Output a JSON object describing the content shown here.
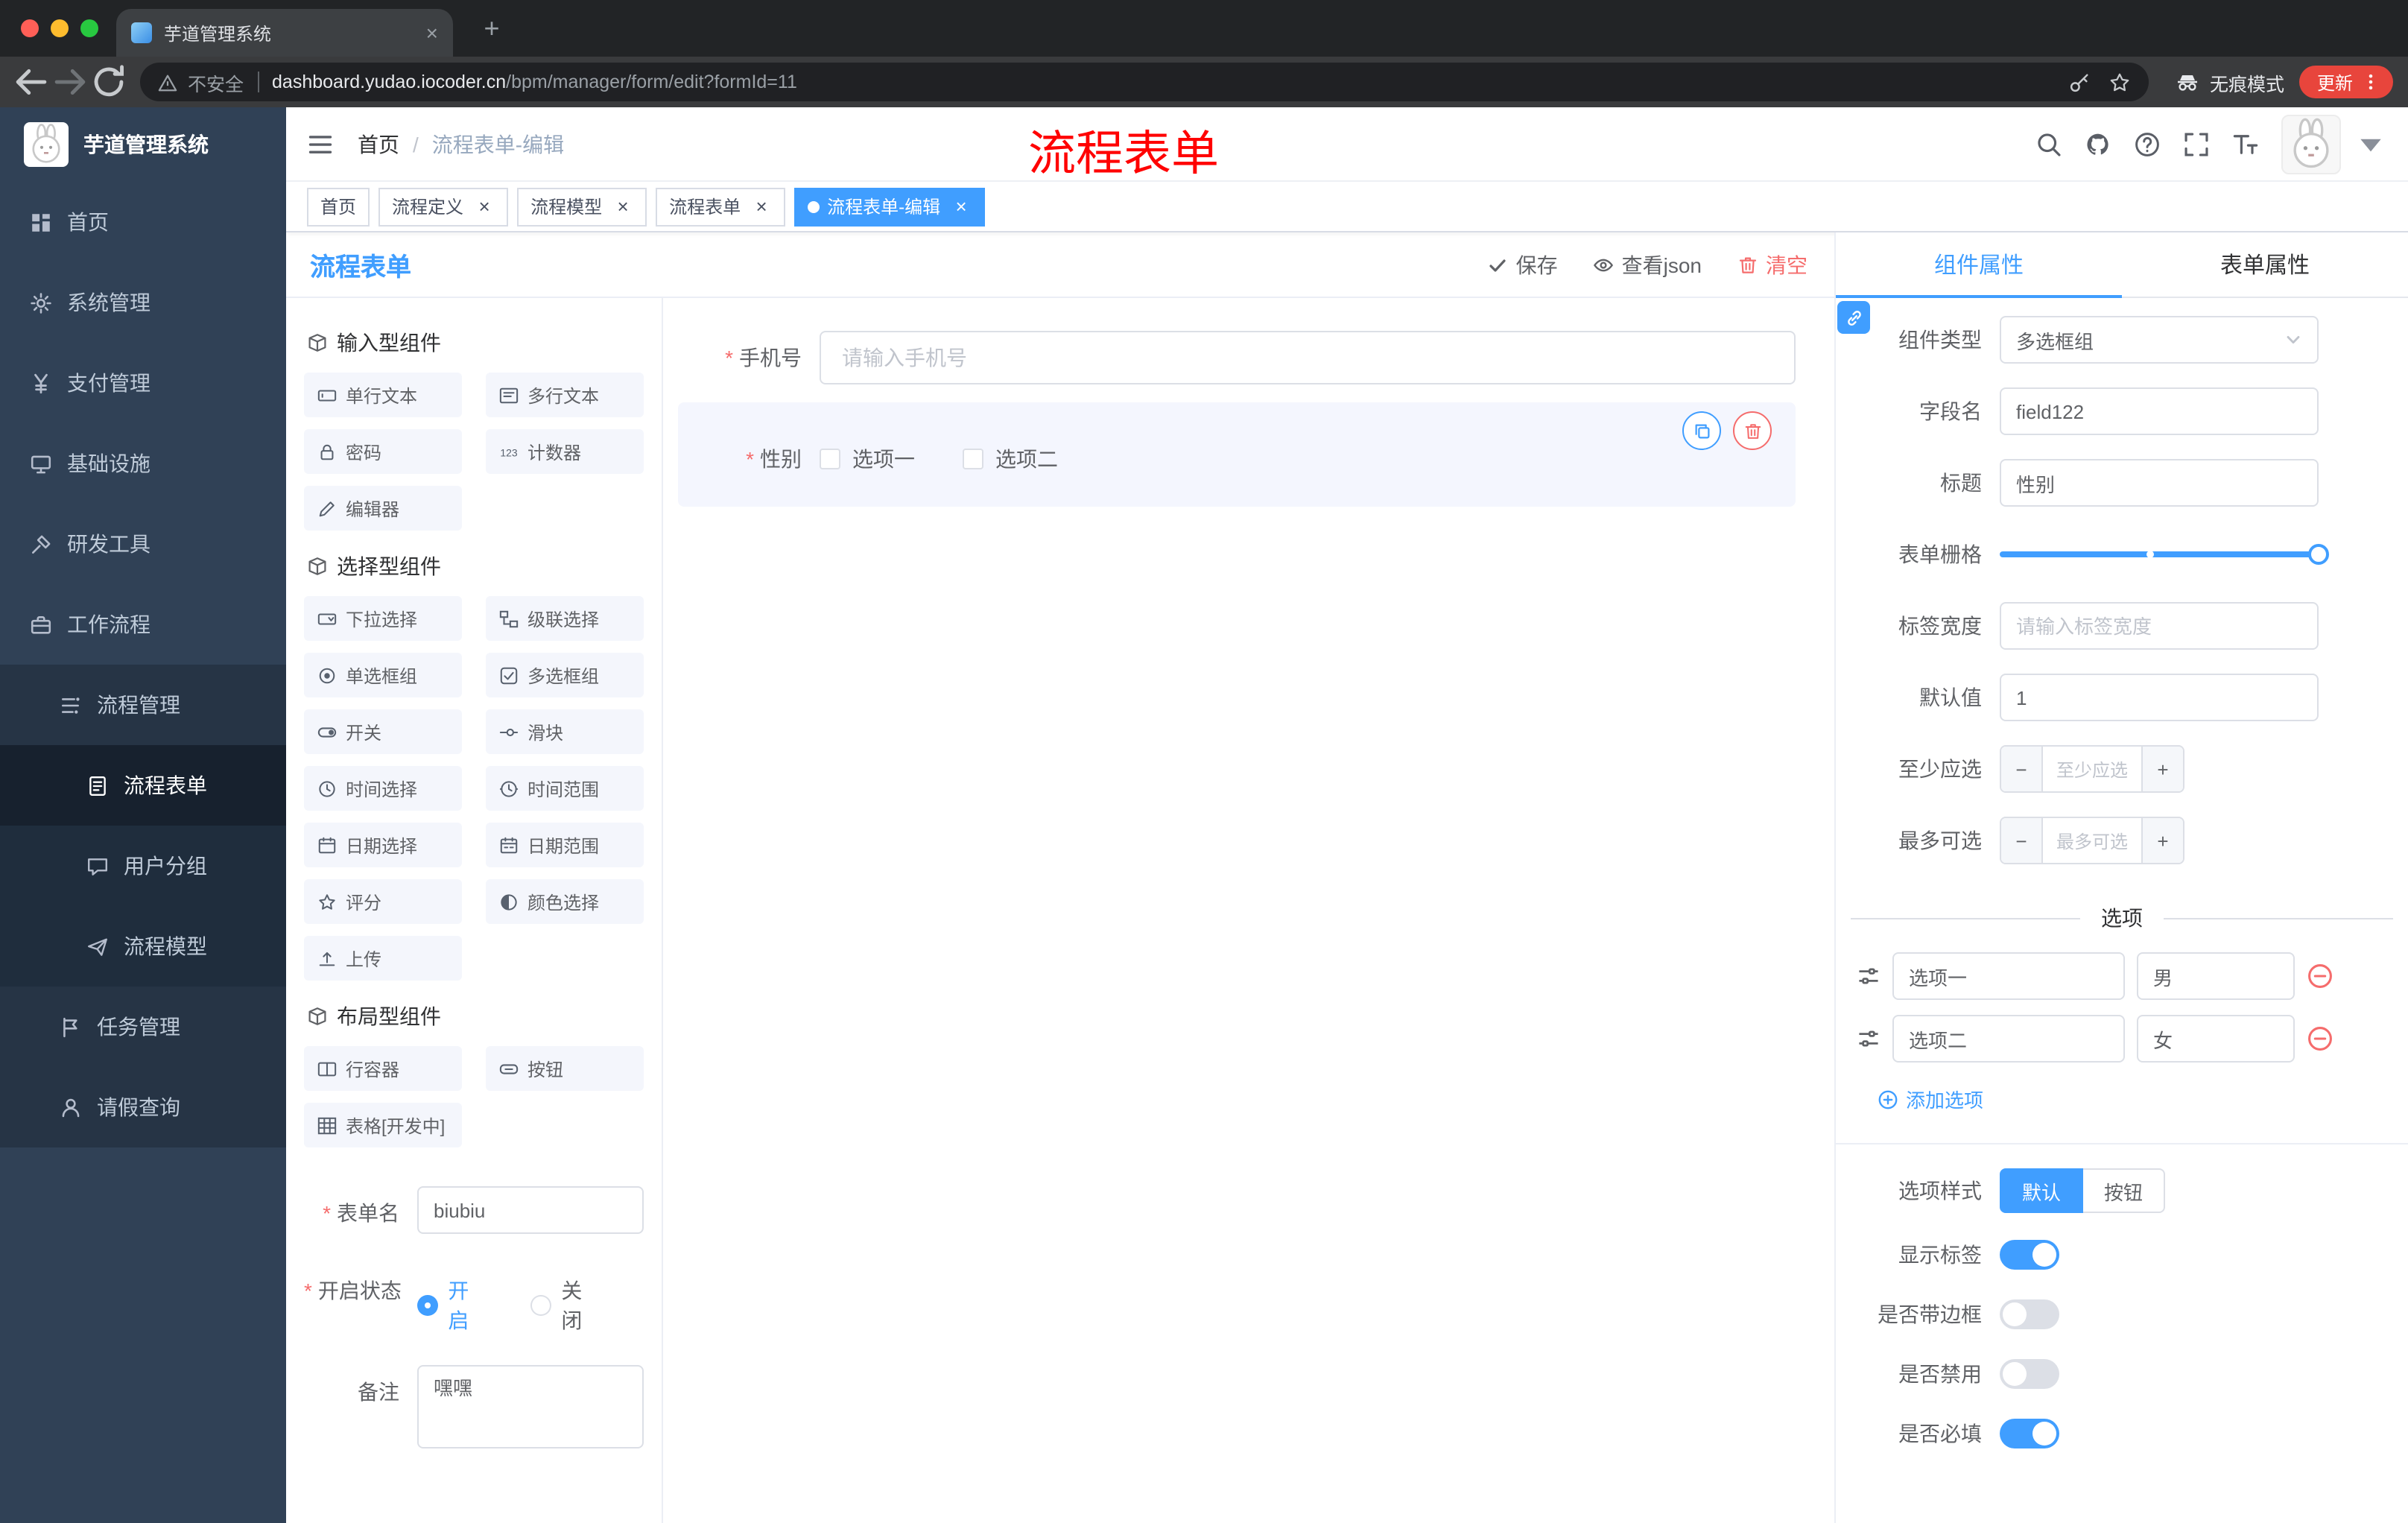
{
  "colors": {
    "primary": "#409EFF",
    "danger": "#F56C6C",
    "sidebar": "#304156",
    "annotation": "#FF0000",
    "update_button": "#E8453C"
  },
  "browser": {
    "tab_title": "芋道管理系统",
    "security_label": "不安全",
    "url_host": "dashboard.yudao.iocoder.cn",
    "url_path": "/bpm/manager/form/edit?formId=11",
    "incognito_label": "无痕模式",
    "update_label": "更新"
  },
  "sidebar": {
    "title": "芋道管理系统",
    "menu": [
      {
        "label": "首页",
        "icon": "home-icon",
        "level": 1
      },
      {
        "label": "系统管理",
        "icon": "gear-icon",
        "level": 1,
        "chevron": "down"
      },
      {
        "label": "支付管理",
        "icon": "yen-icon",
        "level": 1,
        "chevron": "down"
      },
      {
        "label": "基础设施",
        "icon": "infra-icon",
        "level": 1,
        "chevron": "down"
      },
      {
        "label": "研发工具",
        "icon": "tools-icon",
        "level": 1,
        "chevron": "down"
      },
      {
        "label": "工作流程",
        "icon": "workflow-icon",
        "level": 1,
        "chevron": "up"
      },
      {
        "label": "流程管理",
        "icon": "tree-icon",
        "level": 2,
        "chevron": "up"
      },
      {
        "label": "流程表单",
        "icon": "doc-icon",
        "level": 3,
        "active": true
      },
      {
        "label": "用户分组",
        "icon": "chat-icon",
        "level": 3
      },
      {
        "label": "流程模型",
        "icon": "send-icon",
        "level": 3
      },
      {
        "label": "任务管理",
        "icon": "flag-icon",
        "level": 2,
        "chevron": "down"
      },
      {
        "label": "请假查询",
        "icon": "user-icon",
        "level": 2
      }
    ]
  },
  "app_header": {
    "breadcrumb": {
      "root": "首页",
      "current": "流程表单-编辑"
    },
    "annotation": "流程表单"
  },
  "tags": [
    {
      "label": "首页",
      "closable": false,
      "active": false
    },
    {
      "label": "流程定义",
      "closable": true,
      "active": false
    },
    {
      "label": "流程模型",
      "closable": true,
      "active": false
    },
    {
      "label": "流程表单",
      "closable": true,
      "active": false
    },
    {
      "label": "流程表单-编辑",
      "closable": true,
      "active": true
    }
  ],
  "editor": {
    "title": "流程表单",
    "toolbar": {
      "save": "保存",
      "view_json": "查看json",
      "clear": "清空"
    },
    "groups": [
      {
        "title": "输入型组件",
        "items": [
          {
            "label": "单行文本",
            "icon": "input-icon"
          },
          {
            "label": "多行文本",
            "icon": "textarea-icon"
          },
          {
            "label": "密码",
            "icon": "lock-icon"
          },
          {
            "label": "计数器",
            "icon": "counter-icon"
          },
          {
            "label": "编辑器",
            "icon": "editor-icon"
          }
        ]
      },
      {
        "title": "选择型组件",
        "items": [
          {
            "label": "下拉选择",
            "icon": "select-icon"
          },
          {
            "label": "级联选择",
            "icon": "cascader-icon"
          },
          {
            "label": "单选框组",
            "icon": "radio-icon"
          },
          {
            "label": "多选框组",
            "icon": "checkbox-icon"
          },
          {
            "label": "开关",
            "icon": "switch-icon"
          },
          {
            "label": "滑块",
            "icon": "slider-icon"
          },
          {
            "label": "时间选择",
            "icon": "time-icon"
          },
          {
            "label": "时间范围",
            "icon": "time-range-icon"
          },
          {
            "label": "日期选择",
            "icon": "date-icon"
          },
          {
            "label": "日期范围",
            "icon": "date-range-icon"
          },
          {
            "label": "评分",
            "icon": "star-icon"
          },
          {
            "label": "颜色选择",
            "icon": "color-icon"
          },
          {
            "label": "上传",
            "icon": "upload-icon"
          }
        ]
      },
      {
        "title": "布局型组件",
        "items": [
          {
            "label": "行容器",
            "icon": "row-icon"
          },
          {
            "label": "按钮",
            "icon": "button-icon"
          },
          {
            "label": "表格[开发中]",
            "icon": "table-icon"
          }
        ]
      }
    ],
    "meta": {
      "form_name_label": "表单名",
      "form_name_value": "biubiu",
      "status_label": "开启状态",
      "status_on": "开启",
      "status_off": "关闭",
      "remark_label": "备注",
      "remark_value": "嘿嘿"
    },
    "canvas": {
      "phone": {
        "label": "手机号",
        "placeholder": "请输入手机号"
      },
      "gender": {
        "label": "性别",
        "options": [
          "选项一",
          "选项二"
        ]
      }
    }
  },
  "props_panel": {
    "tabs": {
      "component": "组件属性",
      "form": "表单属性"
    },
    "fields": {
      "type_label": "组件类型",
      "type_value": "多选框组",
      "field_label": "字段名",
      "field_value": "field122",
      "title_label": "标题",
      "title_value": "性别",
      "grid_label": "表单栅格",
      "label_width_label": "标签宽度",
      "label_width_placeholder": "请输入标签宽度",
      "default_label": "默认值",
      "default_value": "1",
      "min_label": "至少应选",
      "min_placeholder": "至少应选",
      "max_label": "最多可选",
      "max_placeholder": "最多可选"
    },
    "options": {
      "divider": "选项",
      "rows": [
        {
          "name": "选项一",
          "value": "男"
        },
        {
          "name": "选项二",
          "value": "女"
        }
      ],
      "add": "添加选项"
    },
    "style": {
      "label": "选项样式",
      "default": "默认",
      "button": "按钮"
    },
    "toggles": [
      {
        "label": "显示标签",
        "on": true
      },
      {
        "label": "是否带边框",
        "on": false
      },
      {
        "label": "是否禁用",
        "on": false
      },
      {
        "label": "是否必填",
        "on": true
      }
    ]
  }
}
